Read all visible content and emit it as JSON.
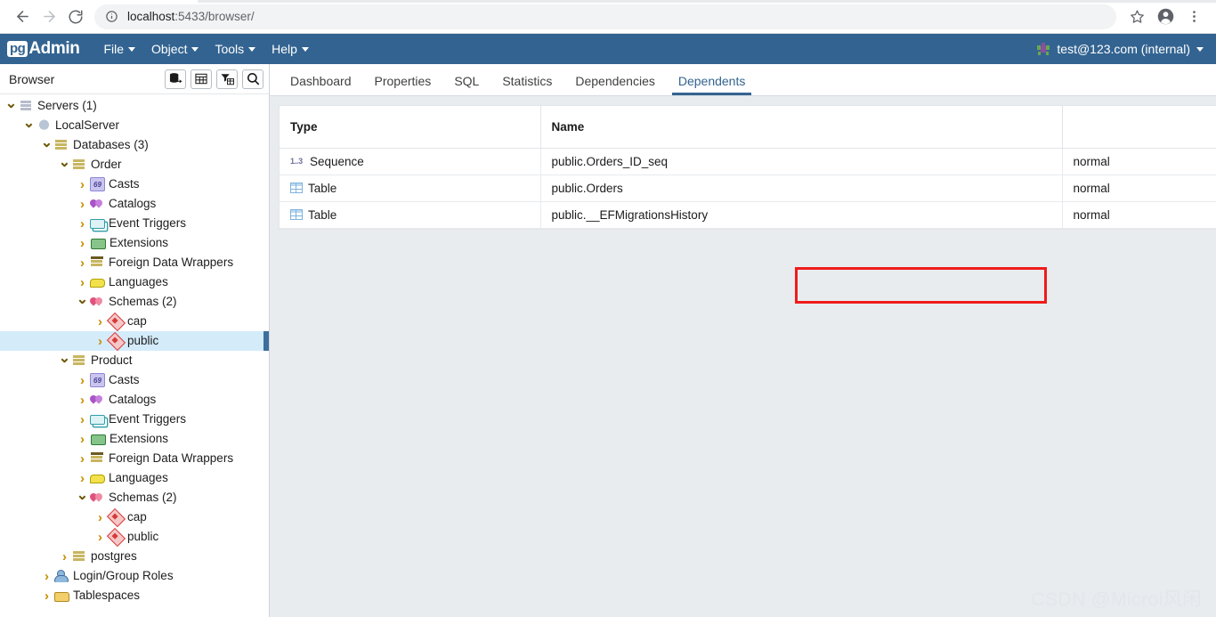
{
  "browser": {
    "url_scheme_text": "localhost",
    "url_rest_text": ":5433/browser/",
    "back_icon": "back-arrow-icon",
    "forward_icon": "forward-arrow-icon",
    "reload_icon": "reload-icon",
    "info_icon": "site-info-icon",
    "bookmark_icon": "star-icon",
    "profile_icon": "profile-avatar-icon",
    "menu_icon": "three-dot-menu-icon"
  },
  "app": {
    "logo_badge": "pg",
    "logo_word": "Admin",
    "menus": [
      {
        "label": "File"
      },
      {
        "label": "Object"
      },
      {
        "label": "Tools"
      },
      {
        "label": "Help"
      }
    ],
    "user": {
      "label": "test@123.com (internal)",
      "avatar_icon": "user-avatar-icon"
    }
  },
  "sidebar": {
    "title": "Browser",
    "tools": [
      {
        "name": "object-explorer-icon"
      },
      {
        "name": "grid-icon"
      },
      {
        "name": "filter-icon"
      },
      {
        "name": "search-icon"
      }
    ],
    "tree": [
      {
        "label": "Servers (1)",
        "indent": 0,
        "state": "open",
        "icon": "servers-icon",
        "selected": false
      },
      {
        "label": "LocalServer",
        "indent": 1,
        "state": "open",
        "icon": "postgres-icon",
        "selected": false
      },
      {
        "label": "Databases (3)",
        "indent": 2,
        "state": "open",
        "icon": "database-icon",
        "selected": false
      },
      {
        "label": "Order",
        "indent": 3,
        "state": "open",
        "icon": "database-icon",
        "selected": false
      },
      {
        "label": "Casts",
        "indent": 4,
        "state": "closed",
        "icon": "casts-icon",
        "selected": false
      },
      {
        "label": "Catalogs",
        "indent": 4,
        "state": "closed",
        "icon": "catalogs-icon",
        "selected": false
      },
      {
        "label": "Event Triggers",
        "indent": 4,
        "state": "closed",
        "icon": "event-trigger-icon",
        "selected": false
      },
      {
        "label": "Extensions",
        "indent": 4,
        "state": "closed",
        "icon": "extension-icon",
        "selected": false
      },
      {
        "label": "Foreign Data Wrappers",
        "indent": 4,
        "state": "closed",
        "icon": "fdw-icon",
        "selected": false
      },
      {
        "label": "Languages",
        "indent": 4,
        "state": "closed",
        "icon": "language-icon",
        "selected": false
      },
      {
        "label": "Schemas (2)",
        "indent": 4,
        "state": "open",
        "icon": "schemas-icon",
        "selected": false
      },
      {
        "label": "cap",
        "indent": 5,
        "state": "closed",
        "icon": "schema-icon",
        "selected": false
      },
      {
        "label": "public",
        "indent": 5,
        "state": "closed",
        "icon": "schema-icon",
        "selected": true
      },
      {
        "label": "Product",
        "indent": 3,
        "state": "open",
        "icon": "database-icon",
        "selected": false
      },
      {
        "label": "Casts",
        "indent": 4,
        "state": "closed",
        "icon": "casts-icon",
        "selected": false
      },
      {
        "label": "Catalogs",
        "indent": 4,
        "state": "closed",
        "icon": "catalogs-icon",
        "selected": false
      },
      {
        "label": "Event Triggers",
        "indent": 4,
        "state": "closed",
        "icon": "event-trigger-icon",
        "selected": false
      },
      {
        "label": "Extensions",
        "indent": 4,
        "state": "closed",
        "icon": "extension-icon",
        "selected": false
      },
      {
        "label": "Foreign Data Wrappers",
        "indent": 4,
        "state": "closed",
        "icon": "fdw-icon",
        "selected": false
      },
      {
        "label": "Languages",
        "indent": 4,
        "state": "closed",
        "icon": "language-icon",
        "selected": false
      },
      {
        "label": "Schemas (2)",
        "indent": 4,
        "state": "open",
        "icon": "schemas-icon",
        "selected": false
      },
      {
        "label": "cap",
        "indent": 5,
        "state": "closed",
        "icon": "schema-icon",
        "selected": false
      },
      {
        "label": "public",
        "indent": 5,
        "state": "closed",
        "icon": "schema-icon",
        "selected": false
      },
      {
        "label": "postgres",
        "indent": 3,
        "state": "closed",
        "icon": "database-icon",
        "selected": false
      },
      {
        "label": "Login/Group Roles",
        "indent": 2,
        "state": "closed",
        "icon": "roles-icon",
        "selected": false
      },
      {
        "label": "Tablespaces",
        "indent": 2,
        "state": "closed",
        "icon": "tablespace-icon",
        "selected": false
      }
    ]
  },
  "main": {
    "tabs": [
      {
        "label": "Dashboard",
        "active": false
      },
      {
        "label": "Properties",
        "active": false
      },
      {
        "label": "SQL",
        "active": false
      },
      {
        "label": "Statistics",
        "active": false
      },
      {
        "label": "Dependencies",
        "active": false
      },
      {
        "label": "Dependents",
        "active": true
      }
    ],
    "table": {
      "columns": [
        "Type",
        "Name",
        ""
      ],
      "rows": [
        {
          "icon": "sequence-icon",
          "type": "Sequence",
          "name": "public.Orders_ID_seq",
          "restriction": "normal",
          "highlighted": false
        },
        {
          "icon": "table-icon",
          "type": "Table",
          "name": "public.Orders",
          "restriction": "normal",
          "highlighted": true
        },
        {
          "icon": "table-icon",
          "type": "Table",
          "name": "public.__EFMigrationsHistory",
          "restriction": "normal",
          "highlighted": false
        }
      ],
      "highlight_color": "#ef1b1b"
    }
  },
  "watermark": "CSDN @Microi风闲",
  "colors": {
    "header_blue": "#336491",
    "selection_blue": "#d4ebfa",
    "accent": "#336491"
  }
}
